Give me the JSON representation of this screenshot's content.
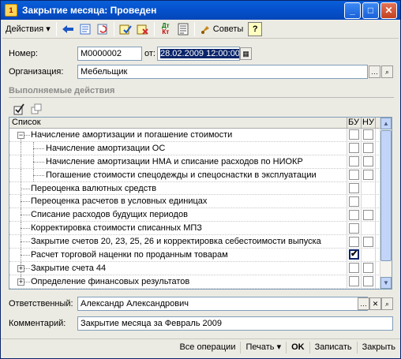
{
  "window": {
    "title": "Закрытие месяца: Проведен"
  },
  "toolbar": {
    "actions_label": "Действия",
    "advice_label": "Советы",
    "help_label": "?",
    "dt_label": "Дт",
    "kt_label": "Кт"
  },
  "form": {
    "number_label": "Номер:",
    "number_value": "М0000002",
    "date_label": "от:",
    "date_value": "28.02.2009 12:00:00",
    "org_label": "Организация:",
    "org_value": "Мебельщик"
  },
  "section": {
    "title": "Выполняемые действия"
  },
  "grid": {
    "columns": {
      "list": "Список",
      "bu": "БУ",
      "nu": "НУ"
    },
    "rows": [
      {
        "label": "Начисление амортизации и погашение стоимости",
        "level": 0,
        "expander": "−",
        "bu": false,
        "nu": false
      },
      {
        "label": "Начисление амортизации ОС",
        "level": 1,
        "expander": "",
        "bu": false,
        "nu": false
      },
      {
        "label": "Начисление амортизации НМА и списание расходов по НИОКР",
        "level": 1,
        "expander": "",
        "bu": false,
        "nu": false
      },
      {
        "label": "Погашение стоимости спецодежды и спецоснастки в эксплуатации",
        "level": 1,
        "expander": "",
        "bu": false,
        "nu": false
      },
      {
        "label": "Переоценка валютных средств",
        "level": 0,
        "expander": "",
        "bu": false,
        "nu": null
      },
      {
        "label": "Переоценка расчетов в условных единицах",
        "level": 0,
        "expander": "",
        "bu": false,
        "nu": null
      },
      {
        "label": "Списание расходов будущих периодов",
        "level": 0,
        "expander": "",
        "bu": false,
        "nu": false
      },
      {
        "label": "Корректировка стоимости списанных МПЗ",
        "level": 0,
        "expander": "",
        "bu": false,
        "nu": null
      },
      {
        "label": "Закрытие счетов 20, 23, 25, 26 и корректировка себестоимости выпуска",
        "level": 0,
        "expander": "",
        "bu": false,
        "nu": false
      },
      {
        "label": "Расчет торговой наценки по проданным товарам",
        "level": 0,
        "expander": "",
        "bu": true,
        "nu": null
      },
      {
        "label": "Закрытие счета 44",
        "level": 0,
        "expander": "+",
        "bu": false,
        "nu": false
      },
      {
        "label": "Определение финансовых результатов",
        "level": 0,
        "expander": "+",
        "bu": false,
        "nu": false
      }
    ]
  },
  "footer_fields": {
    "responsible_label": "Ответственный:",
    "responsible_value": "Александр Александрович",
    "comment_label": "Комментарий:",
    "comment_value": "Закрытие месяца за Февраль 2009"
  },
  "bottom": {
    "all_ops": "Все операции",
    "print": "Печать",
    "ok": "OK",
    "save": "Записать",
    "close": "Закрыть"
  },
  "colors": {
    "titlebar": "#0553cf",
    "selection": "#0a246a",
    "window_bg": "#ecebe3"
  }
}
